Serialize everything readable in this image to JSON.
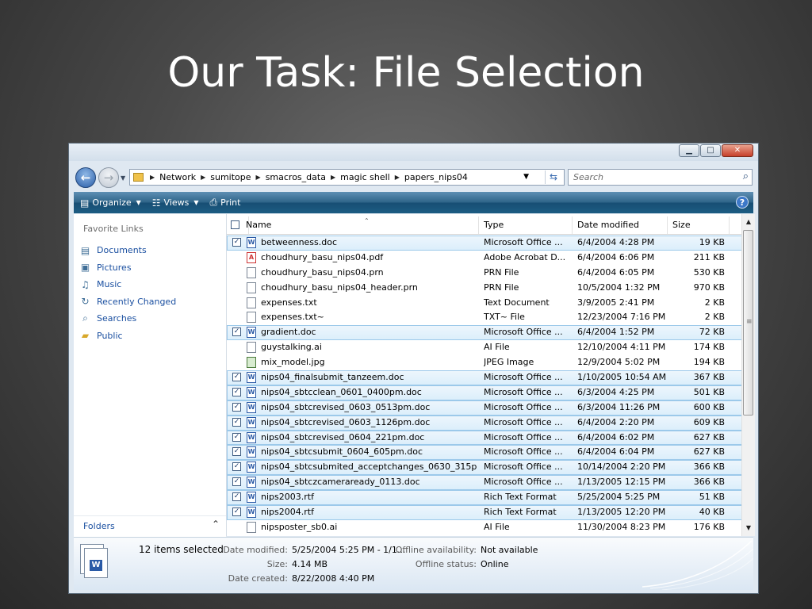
{
  "slide": {
    "title": "Our Task: File Selection"
  },
  "window": {
    "address": {
      "crumbs": [
        "Network",
        "sumitope",
        "smacros_data",
        "magic shell",
        "papers_nips04"
      ]
    },
    "search": {
      "placeholder": "Search"
    },
    "toolbar": {
      "organize": "Organize",
      "views": "Views",
      "print": "Print",
      "help": "?"
    },
    "nav": {
      "favorite_header": "Favorite Links",
      "links": [
        "Documents",
        "Pictures",
        "Music",
        "Recently Changed",
        "Searches",
        "Public"
      ],
      "folders": "Folders"
    },
    "columns": {
      "name": "Name",
      "type": "Type",
      "date": "Date modified",
      "size": "Size"
    },
    "files": [
      {
        "name": "betweenness.doc",
        "type": "Microsoft Office ...",
        "date": "6/4/2004 4:28 PM",
        "size": "19 KB",
        "checked": "✓",
        "icon": "W"
      },
      {
        "name": "choudhury_basu_nips04.pdf",
        "type": "Adobe Acrobat D...",
        "date": "6/4/2004 6:06 PM",
        "size": "211 KB",
        "checked": "",
        "icon": "A"
      },
      {
        "name": "choudhury_basu_nips04.prn",
        "type": "PRN File",
        "date": "6/4/2004 6:05 PM",
        "size": "530 KB",
        "checked": "",
        "icon": ""
      },
      {
        "name": "choudhury_basu_nips04_header.prn",
        "type": "PRN File",
        "date": "10/5/2004 1:32 PM",
        "size": "970 KB",
        "checked": "",
        "icon": ""
      },
      {
        "name": "expenses.txt",
        "type": "Text Document",
        "date": "3/9/2005 2:41 PM",
        "size": "2 KB",
        "checked": "",
        "icon": ""
      },
      {
        "name": "expenses.txt~",
        "type": "TXT~ File",
        "date": "12/23/2004 7:16 PM",
        "size": "2 KB",
        "checked": "",
        "icon": ""
      },
      {
        "name": "gradient.doc",
        "type": "Microsoft Office ...",
        "date": "6/4/2004 1:52 PM",
        "size": "72 KB",
        "checked": "✓",
        "icon": "W"
      },
      {
        "name": "guystalking.ai",
        "type": "AI File",
        "date": "12/10/2004 4:11 PM",
        "size": "174 KB",
        "checked": "",
        "icon": ""
      },
      {
        "name": "mix_model.jpg",
        "type": "JPEG Image",
        "date": "12/9/2004 5:02 PM",
        "size": "194 KB",
        "checked": "",
        "icon": ""
      },
      {
        "name": "nips04_finalsubmit_tanzeem.doc",
        "type": "Microsoft Office ...",
        "date": "1/10/2005 10:54 AM",
        "size": "367 KB",
        "checked": "✓",
        "icon": "W"
      },
      {
        "name": "nips04_sbtcclean_0601_0400pm.doc",
        "type": "Microsoft Office ...",
        "date": "6/3/2004 4:25 PM",
        "size": "501 KB",
        "checked": "✓",
        "icon": "W"
      },
      {
        "name": "nips04_sbtcrevised_0603_0513pm.doc",
        "type": "Microsoft Office ...",
        "date": "6/3/2004 11:26 PM",
        "size": "600 KB",
        "checked": "✓",
        "icon": "W"
      },
      {
        "name": "nips04_sbtcrevised_0603_1126pm.doc",
        "type": "Microsoft Office ...",
        "date": "6/4/2004 2:20 PM",
        "size": "609 KB",
        "checked": "✓",
        "icon": "W"
      },
      {
        "name": "nips04_sbtcrevised_0604_221pm.doc",
        "type": "Microsoft Office ...",
        "date": "6/4/2004 6:02 PM",
        "size": "627 KB",
        "checked": "✓",
        "icon": "W"
      },
      {
        "name": "nips04_sbtcsubmit_0604_605pm.doc",
        "type": "Microsoft Office ...",
        "date": "6/4/2004 6:04 PM",
        "size": "627 KB",
        "checked": "✓",
        "icon": "W"
      },
      {
        "name": "nips04_sbtcsubmited_acceptchanges_0630_315pm...",
        "type": "Microsoft Office ...",
        "date": "10/14/2004 2:20 PM",
        "size": "366 KB",
        "checked": "✓",
        "icon": "W"
      },
      {
        "name": "nips04_sbtczcameraready_0113.doc",
        "type": "Microsoft Office ...",
        "date": "1/13/2005 12:15 PM",
        "size": "366 KB",
        "checked": "✓",
        "icon": "W"
      },
      {
        "name": "nips2003.rtf",
        "type": "Rich Text Format",
        "date": "5/25/2004 5:25 PM",
        "size": "51 KB",
        "checked": "✓",
        "icon": "W"
      },
      {
        "name": "nips2004.rtf",
        "type": "Rich Text Format",
        "date": "1/13/2005 12:20 PM",
        "size": "40 KB",
        "checked": "✓",
        "icon": "W"
      },
      {
        "name": "nipsposter_sb0.ai",
        "type": "AI File",
        "date": "11/30/2004 8:23 PM",
        "size": "176 KB",
        "checked": "",
        "icon": ""
      }
    ],
    "details": {
      "selection": "12 items selected",
      "date_modified_label": "Date modified:",
      "date_modified": "5/25/2004 5:25 PM - 1/1...",
      "size_label": "Size:",
      "size": "4.14 MB",
      "date_created_label": "Date created:",
      "date_created": "8/22/2008 4:40 PM",
      "offline_avail_label": "Offline availability:",
      "offline_avail": "Not available",
      "offline_status_label": "Offline status:",
      "offline_status": "Online"
    }
  }
}
